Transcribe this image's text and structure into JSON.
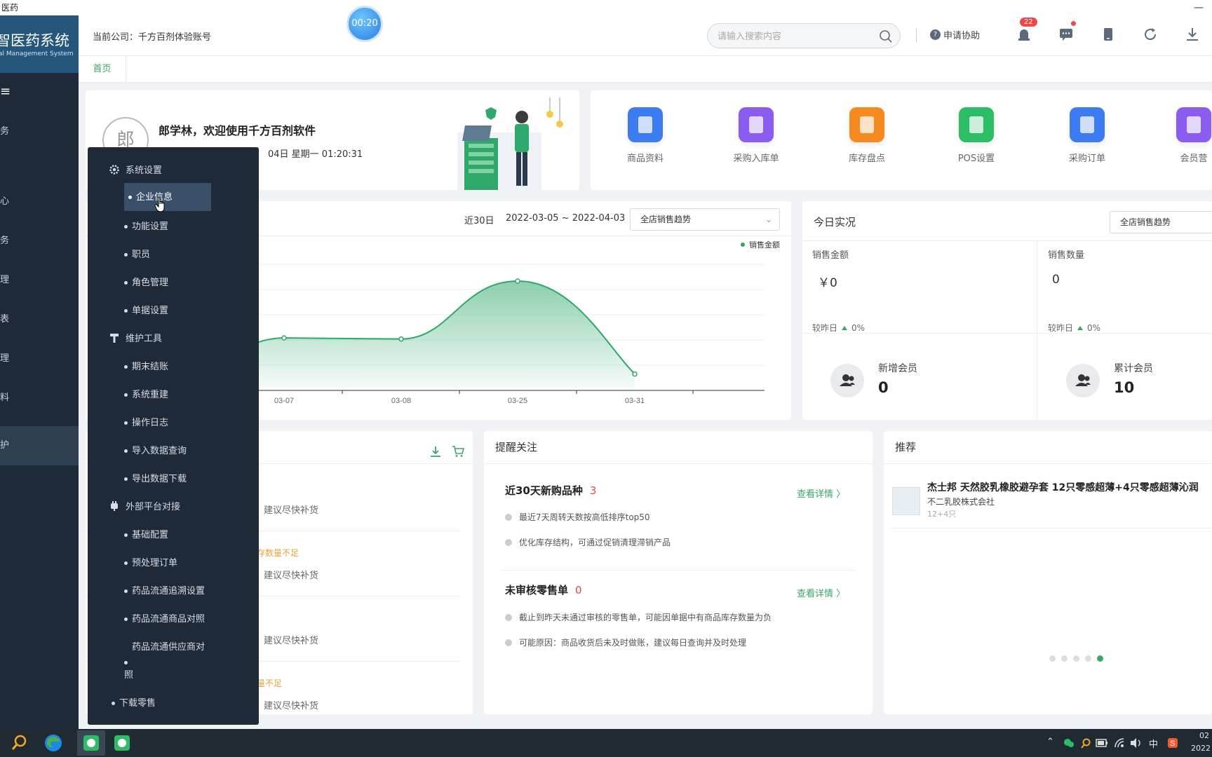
{
  "window": {
    "title": "医药",
    "min_glyph": "—"
  },
  "sidebar": {
    "brand_name": "智医药系统",
    "brand_sub": "al Management System",
    "toggle": "≡",
    "items": [
      "务",
      "心",
      "务",
      "理",
      "表",
      "理",
      "料",
      "护"
    ]
  },
  "header": {
    "company": "当前公司：千方百剂体验账号",
    "timer": "00:20",
    "search_placeholder": "请输入搜索内容",
    "help": "申请协助",
    "help_glyph": "?",
    "notify_count": "22"
  },
  "tabs": {
    "home": "首页"
  },
  "welcome": {
    "avatar": "郎",
    "greeting": "郎学林，欢迎使用千方百剂软件",
    "datetime": "04日 星期一 01:20:31"
  },
  "shortcuts": [
    {
      "label": "商品资料",
      "color": "#3d7cf0"
    },
    {
      "label": "采购入库单",
      "color": "#8a5cf0"
    },
    {
      "label": "库存盘点",
      "color": "#f58a1f"
    },
    {
      "label": "POS设置",
      "color": "#2ebd67"
    },
    {
      "label": "采购订单",
      "color": "#3d7cf0"
    },
    {
      "label": "会员营",
      "color": "#8a5cf0"
    }
  ],
  "sales_chart": {
    "period_label": "近30日",
    "range": "2022-03-05 ~ 2022-04-03",
    "select": "全店销售趋势",
    "legend": "销售金额"
  },
  "chart_data": {
    "type": "area",
    "title": "",
    "x": [
      "03-07",
      "03-08",
      "03-25",
      "03-31"
    ],
    "series": [
      {
        "name": "销售金额",
        "values": [
          0.48,
          0.47,
          1.0,
          0.15
        ]
      }
    ],
    "xlabel": "",
    "ylabel": "",
    "grid": true,
    "legend_position": "top-right",
    "color": "#2ea86b"
  },
  "today": {
    "title": "今日实况",
    "select": "全店销售趋势",
    "sales_amount_label": "销售金额",
    "sales_amount": "￥0",
    "sales_qty_label": "销售数量",
    "sales_qty": "0",
    "compare_label": "较昨日",
    "compare_1": "0%",
    "compare_2": "0%",
    "new_member_label": "新增会员",
    "new_member": "0",
    "total_member_label": "累计会员",
    "total_member": "10"
  },
  "restock": {
    "advice": "建议尽快补货",
    "warn1": "存数量不足",
    "warn2": "量不足"
  },
  "alerts": {
    "title": "提醒关注",
    "new_head": "近30天新购品种",
    "new_count": "3",
    "link": "查看详情 〉",
    "new_items": [
      "最近7天周转天数按高低排序top50",
      "优化库存结构，可通过促销清理滞销产品"
    ],
    "unreview_head": "未审核零售单",
    "unreview_count": "0",
    "unreview_items": [
      "截止到昨天未通过审核的零售单，可能因单据中有商品库存数量为负",
      "可能原因：商品收货后未及时做账，建议每日查询并及时处理"
    ]
  },
  "recommend": {
    "title": "推荐",
    "product_name": "杰士邦 天然胶乳橡胶避孕套 12只零感超薄+4只零感超薄沁润",
    "maker": "不二乳胶株式会社",
    "spec": "12+4只"
  },
  "dropdown": {
    "group1": "系统设置",
    "g1_items": [
      "企业信息",
      "功能设置",
      "职员",
      "角色管理",
      "单据设置"
    ],
    "group2": "维护工具",
    "g2_items": [
      "期末结账",
      "系统重建",
      "操作日志",
      "导入数据查询",
      "导出数据下载"
    ],
    "group3": "外部平台对接",
    "g3_items": [
      "基础配置",
      "预处理订单",
      "药品流通追溯设置",
      "药品流通商品对照",
      "药品流通供应商对"
    ],
    "g3_wrap": "照",
    "last": "下载零售"
  },
  "taskbar": {
    "ime": "中",
    "clock_a": "02",
    "clock_b": "2022"
  }
}
